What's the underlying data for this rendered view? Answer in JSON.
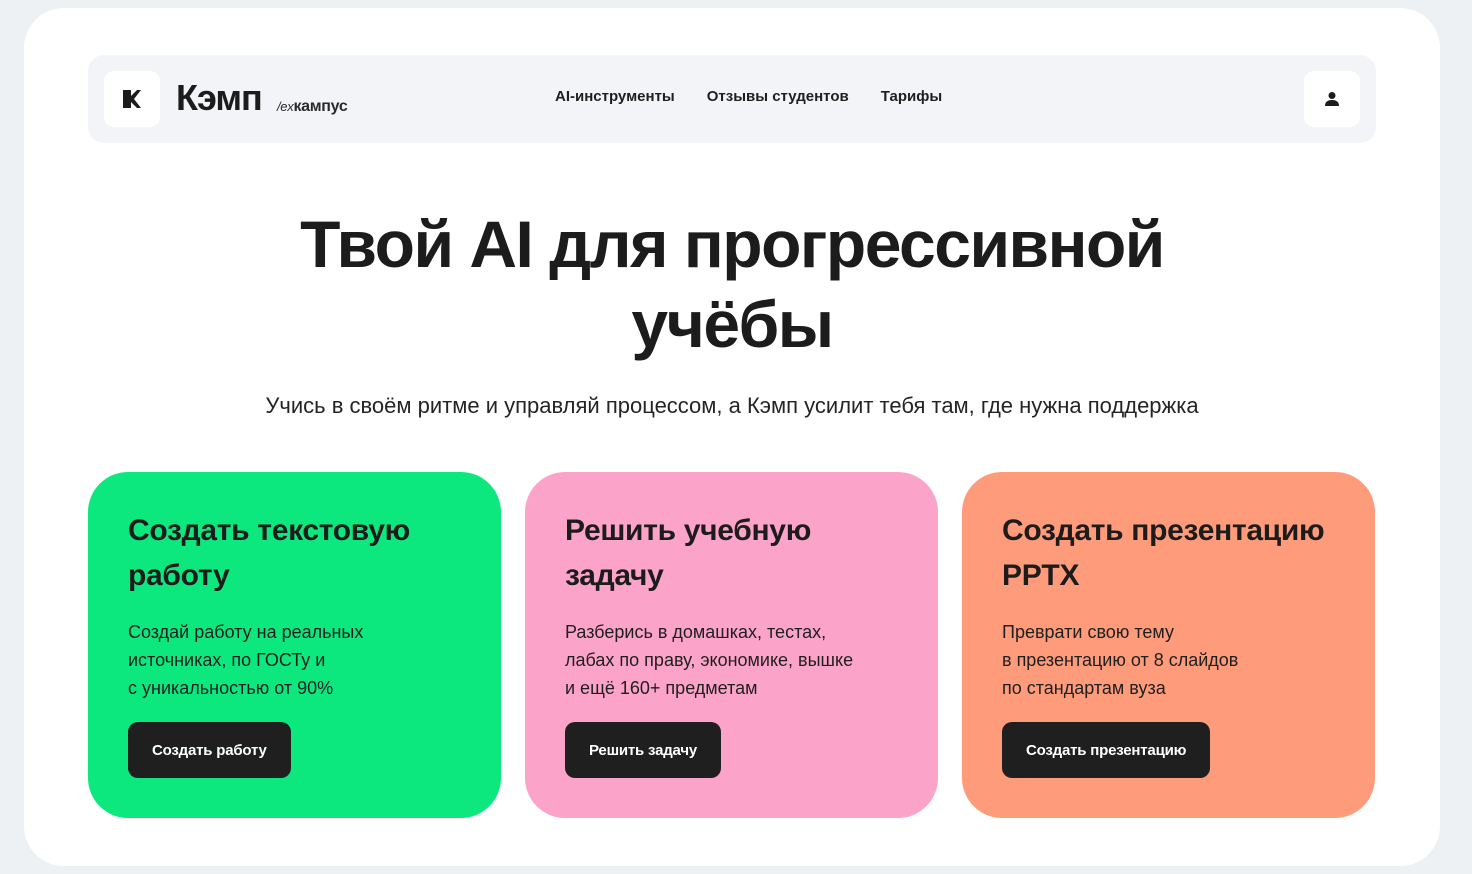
{
  "header": {
    "brand": "Кэмп",
    "brand_sub_prefix": "/ex",
    "brand_sub_name": "кампус",
    "nav": [
      {
        "label": "AI-инструменты"
      },
      {
        "label": "Отзывы студентов"
      },
      {
        "label": "Тарифы"
      }
    ]
  },
  "hero": {
    "title_line1": "Твой AI для прогрессивной",
    "title_line2": "учёбы",
    "subtitle": "Учись в своём ритме и управляй процессом, а Кэмп усилит тебя там, где нужна поддержка"
  },
  "cards": [
    {
      "title": "Создать текстовую работу",
      "lines": [
        "Создай работу на реальных",
        "источниках, по ГОСТу и",
        "с уникальностью от 90%"
      ],
      "button": "Создать работу",
      "color": "#0ce87e"
    },
    {
      "title": "Решить учебную задачу",
      "lines": [
        "Разберись в домашках, тестах,",
        "лабах по праву, экономике, вышке",
        "и ещё 160+ предметам"
      ],
      "button": "Решить задачу",
      "color": "#fca3c9"
    },
    {
      "title": "Создать презентацию PPTX",
      "lines": [
        "Преврати свою тему",
        "в презентацию от 8 слайдов",
        "по стандартам вуза"
      ],
      "button": "Создать презентацию",
      "color": "#fe9b7b"
    }
  ],
  "icons": {
    "logo": "k-logo-icon",
    "user": "user-icon"
  }
}
